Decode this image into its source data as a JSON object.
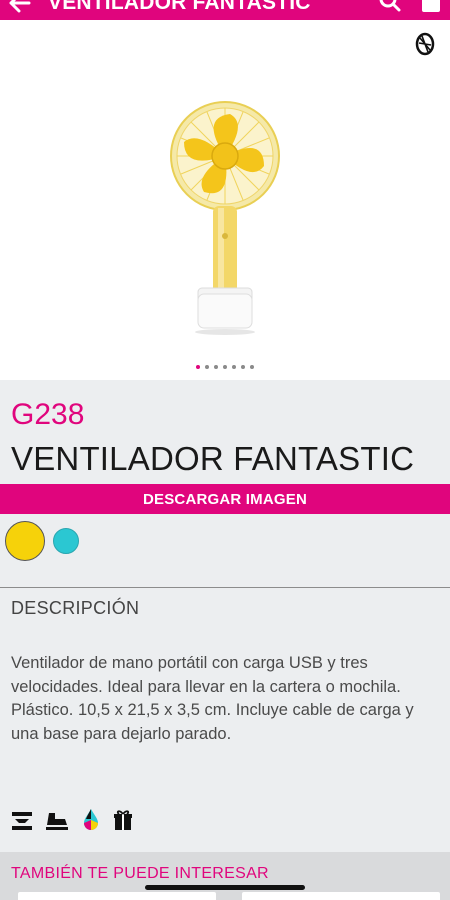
{
  "appbar": {
    "title": "VENTILADOR FANTASTIC",
    "back_icon": "arrow-left-icon",
    "search_icon": "search-icon",
    "bag_icon": "shopping-bag-icon",
    "color": "#e0057d"
  },
  "gallery": {
    "logo_icon": "brand-logo-icon",
    "image_count": 7,
    "active_index": 0
  },
  "product": {
    "code": "G238",
    "name": "VENTILADOR FANTASTIC",
    "download_label": "DESCARGAR IMAGEN",
    "colors": [
      "#f6d20a",
      "#2bc7d2"
    ],
    "description_heading": "DESCRIPCIÓN",
    "description": [
      "Ventilador de mano portátil con carga USB y tres velocidades. Ideal para llevar en la cartera o mochila.",
      "Plástico. 10,5 x 21,5 x 3,5 cm. Incluye cable de carga y una base para dejarlo parado."
    ],
    "print_icons": [
      "screen-print-icon",
      "pad-print-icon",
      "color-print-icon",
      "gift-box-icon"
    ]
  },
  "related": {
    "title": "TAMBIÉN TE PUEDE INTERESAR"
  }
}
